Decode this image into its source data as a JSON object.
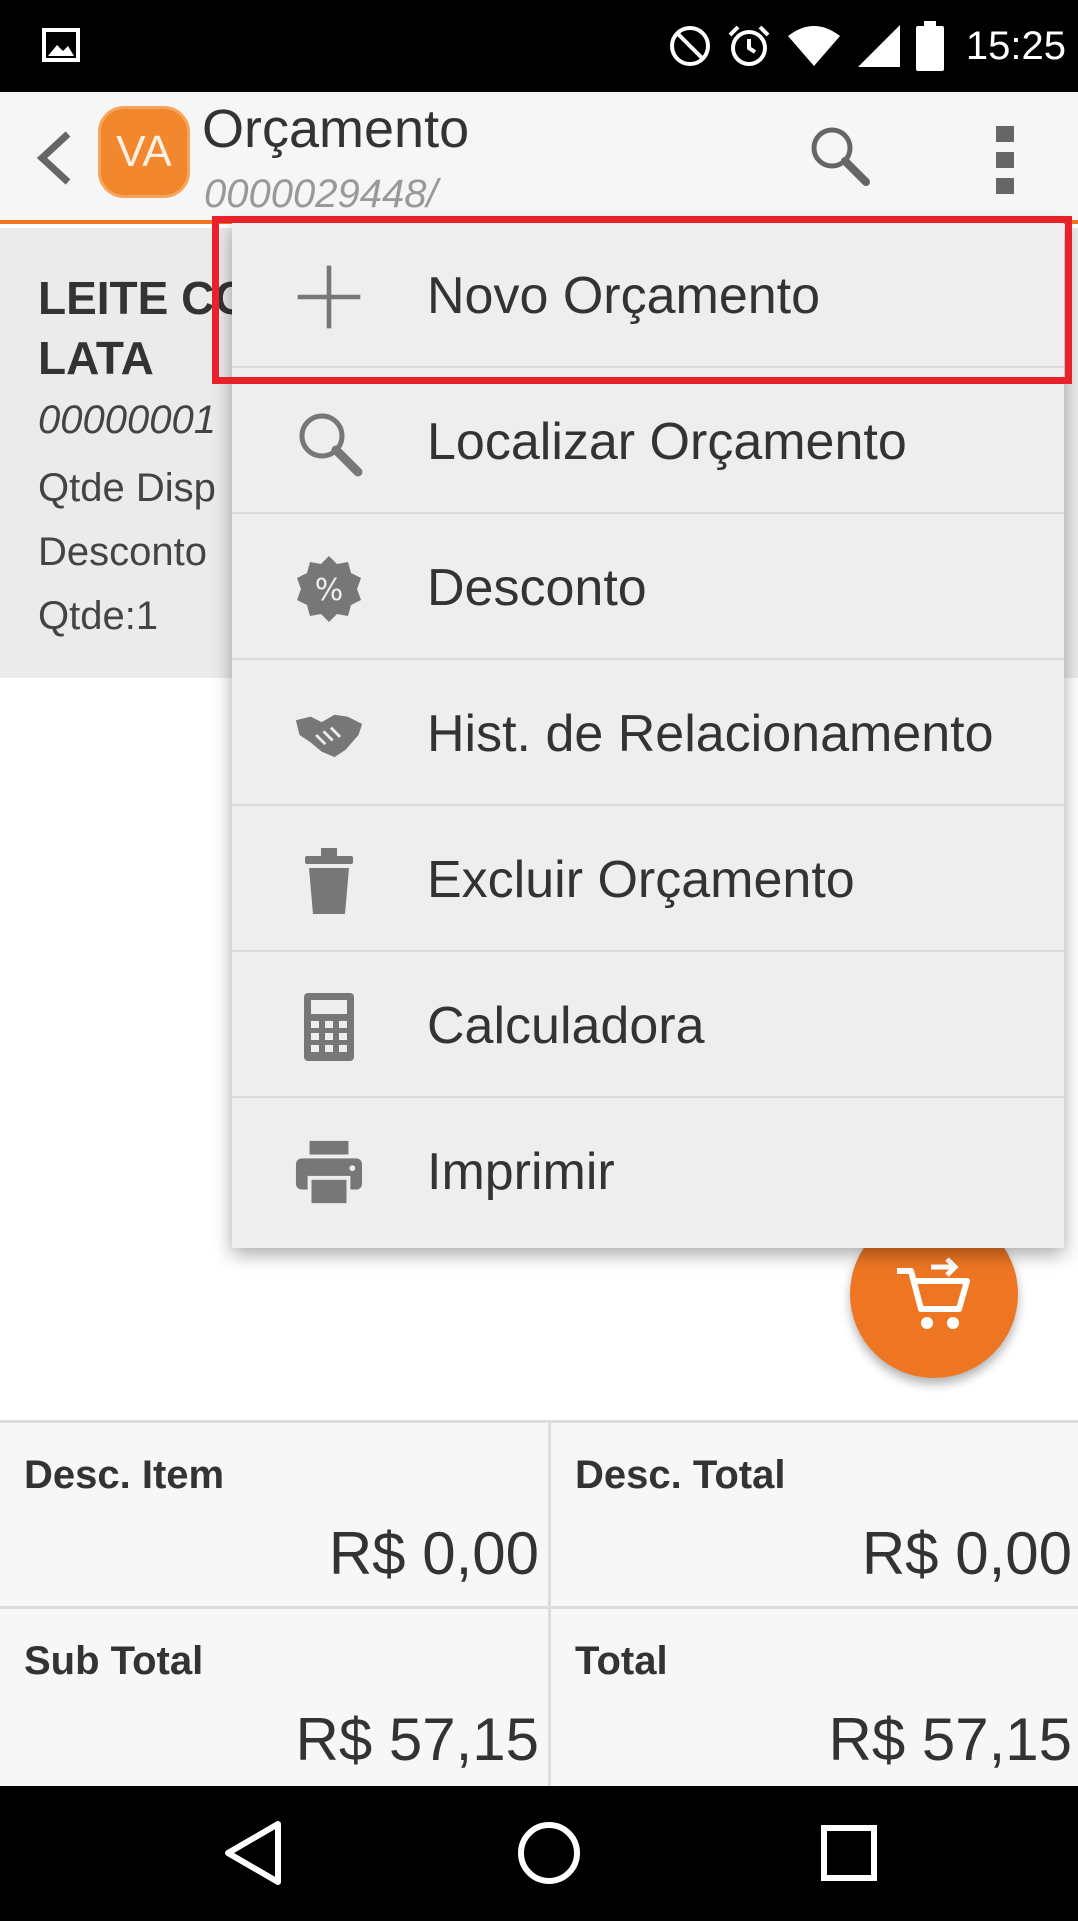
{
  "status_bar": {
    "time": "15:25"
  },
  "toolbar": {
    "avatar_text": "VA",
    "title": "Orçamento",
    "subtitle": "0000029448/"
  },
  "item": {
    "name": "LEITE CO LATA",
    "code": "00000001",
    "qtde_disp_label": "Qtde Disp",
    "desconto_label": "Desconto",
    "qtde": "Qtde:1"
  },
  "menu": {
    "items": [
      {
        "label": "Novo Orçamento",
        "icon": "plus-icon"
      },
      {
        "label": "Localizar Orçamento",
        "icon": "search-icon"
      },
      {
        "label": "Desconto",
        "icon": "percent-badge-icon"
      },
      {
        "label": "Hist. de Relacionamento",
        "icon": "handshake-icon"
      },
      {
        "label": "Excluir Orçamento",
        "icon": "trash-icon"
      },
      {
        "label": "Calculadora",
        "icon": "calculator-icon"
      },
      {
        "label": "Imprimir",
        "icon": "printer-icon"
      }
    ]
  },
  "totals": {
    "desc_item_label": "Desc. Item",
    "desc_item_value": "R$ 0,00",
    "desc_total_label": "Desc. Total",
    "desc_total_value": "R$ 0,00",
    "sub_total_label": "Sub Total",
    "sub_total_value": "R$ 57,15",
    "total_label": "Total",
    "total_value": "R$ 57,15"
  },
  "colors": {
    "accent": "#ee7623",
    "highlight": "#e8212b"
  }
}
